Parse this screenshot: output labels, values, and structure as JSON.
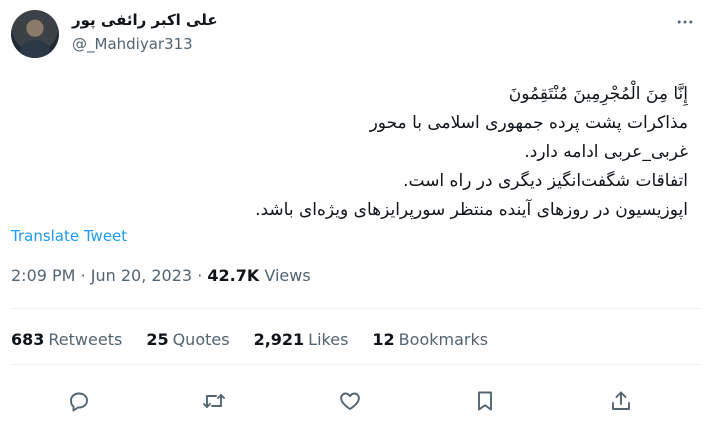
{
  "author": {
    "name": "علی اکبر رائفی پور",
    "handle": "@_Mahdiyar313"
  },
  "tweet": {
    "lines": [
      "إِنَّا مِنَ الْمُجْرِمِينَ مُنْتَقِمُونَ",
      "مذاکرات پشت پرده جمهوری اسلامی با محور",
      "غربی_عربی ادامه دارد.",
      "اتفاقات شگفت‌انگیز دیگری در راه است.",
      "اپوزیسیون در روزهای آینده منتظر سورپرایزهای ویژه‌ای باشد."
    ],
    "translate_label": "Translate Tweet"
  },
  "meta": {
    "time": "2:09 PM",
    "separator": "·",
    "date": "Jun 20, 2023",
    "views_count": "42.7K",
    "views_label": "Views"
  },
  "stats": {
    "retweets_count": "683",
    "retweets_label": "Retweets",
    "quotes_count": "25",
    "quotes_label": "Quotes",
    "likes_count": "2,921",
    "likes_label": "Likes",
    "bookmarks_count": "12",
    "bookmarks_label": "Bookmarks"
  },
  "actions": [
    "reply-icon",
    "retweet-icon",
    "like-icon",
    "bookmark-icon",
    "share-icon"
  ]
}
